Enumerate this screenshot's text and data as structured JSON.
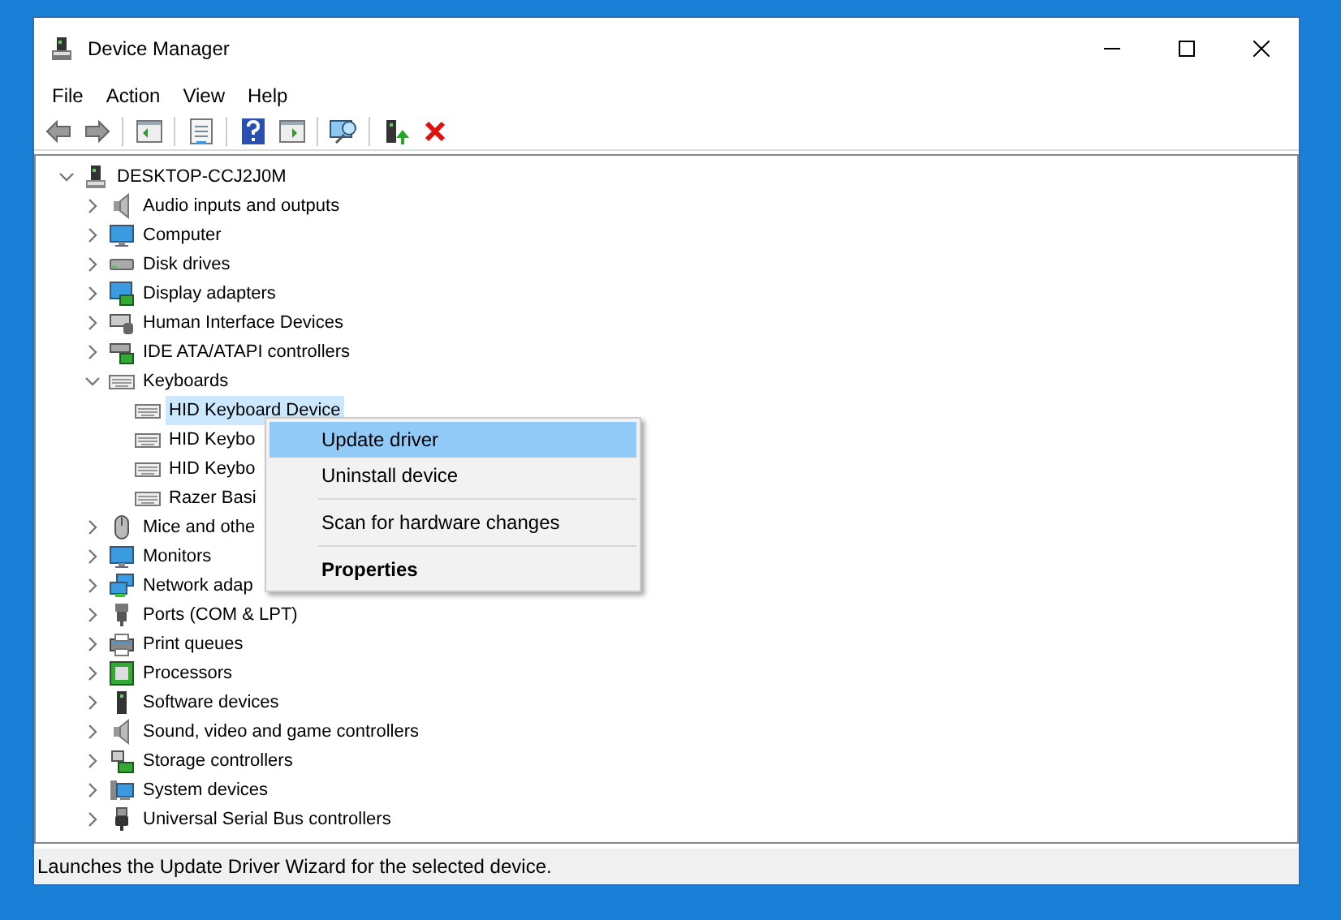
{
  "window": {
    "title": "Device Manager"
  },
  "menu_bar": [
    "File",
    "Action",
    "View",
    "Help"
  ],
  "tree": {
    "label": "DESKTOP-CCJ2J0M",
    "expanded": true,
    "selected": false,
    "children": [
      {
        "label": "Audio inputs and outputs",
        "expanded": false,
        "selected": false
      },
      {
        "label": "Computer",
        "expanded": false,
        "selected": false
      },
      {
        "label": "Disk drives",
        "expanded": false,
        "selected": false
      },
      {
        "label": "Display adapters",
        "expanded": false,
        "selected": false
      },
      {
        "label": "Human Interface Devices",
        "expanded": false,
        "selected": false
      },
      {
        "label": "IDE ATA/ATAPI controllers",
        "expanded": false,
        "selected": false
      },
      {
        "label": "Keyboards",
        "expanded": true,
        "selected": false,
        "children": [
          {
            "label": "HID Keyboard Device",
            "selected": true
          },
          {
            "label": "HID Keybo",
            "selected": false
          },
          {
            "label": "HID Keybo",
            "selected": false
          },
          {
            "label": "Razer Basi",
            "selected": false
          }
        ]
      },
      {
        "label": "Mice and othe",
        "expanded": false,
        "selected": false
      },
      {
        "label": "Monitors",
        "expanded": false,
        "selected": false
      },
      {
        "label": "Network adap",
        "expanded": false,
        "selected": false
      },
      {
        "label": "Ports (COM & LPT)",
        "expanded": false,
        "selected": false
      },
      {
        "label": "Print queues",
        "expanded": false,
        "selected": false
      },
      {
        "label": "Processors",
        "expanded": false,
        "selected": false
      },
      {
        "label": "Software devices",
        "expanded": false,
        "selected": false
      },
      {
        "label": "Sound, video and game controllers",
        "expanded": false,
        "selected": false
      },
      {
        "label": "Storage controllers",
        "expanded": false,
        "selected": false
      },
      {
        "label": "System devices",
        "expanded": false,
        "selected": false
      },
      {
        "label": "Universal Serial Bus controllers",
        "expanded": false,
        "selected": false
      }
    ]
  },
  "context_menu": [
    {
      "kind": "item",
      "label": "Update driver",
      "selected": true
    },
    {
      "kind": "item",
      "label": "Uninstall device",
      "selected": false
    },
    {
      "kind": "separator"
    },
    {
      "kind": "item",
      "label": "Scan for hardware changes",
      "selected": false
    },
    {
      "kind": "separator"
    },
    {
      "kind": "default",
      "label": "Properties",
      "selected": false
    }
  ],
  "status_bar": "Launches the Update Driver Wizard for the selected device."
}
